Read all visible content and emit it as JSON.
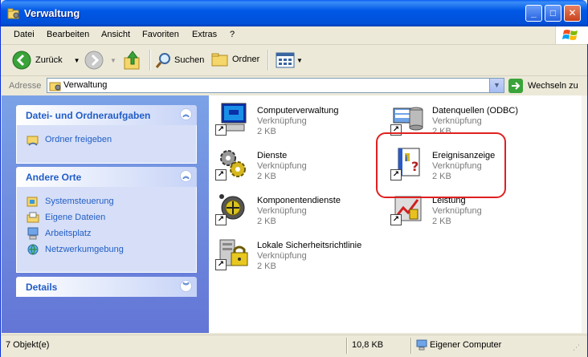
{
  "window": {
    "title": "Verwaltung"
  },
  "menu": [
    "Datei",
    "Bearbeiten",
    "Ansicht",
    "Favoriten",
    "Extras",
    "?"
  ],
  "toolbar": {
    "back_label": "Zurück",
    "search_label": "Suchen",
    "folders_label": "Ordner"
  },
  "address": {
    "label": "Adresse",
    "value": "Verwaltung",
    "go_label": "Wechseln zu"
  },
  "panels": {
    "tasks": {
      "title": "Datei- und Ordneraufgaben",
      "items": [
        "Ordner freigeben"
      ]
    },
    "places": {
      "title": "Andere Orte",
      "items": [
        "Systemsteuerung",
        "Eigene Dateien",
        "Arbeitsplatz",
        "Netzwerkumgebung"
      ]
    },
    "details": {
      "title": "Details"
    }
  },
  "files": [
    {
      "name": "Computerverwaltung",
      "type": "Verknüpfung",
      "size": "2 KB"
    },
    {
      "name": "Datenquellen (ODBC)",
      "type": "Verknüpfung",
      "size": "2 KB"
    },
    {
      "name": "Dienste",
      "type": "Verknüpfung",
      "size": "2 KB"
    },
    {
      "name": "Ereignisanzeige",
      "type": "Verknüpfung",
      "size": "2 KB"
    },
    {
      "name": "Komponentendienste",
      "type": "Verknüpfung",
      "size": "2 KB"
    },
    {
      "name": "Leistung",
      "type": "Verknüpfung",
      "size": "2 KB"
    },
    {
      "name": "Lokale Sicherheitsrichtlinie",
      "type": "Verknüpfung",
      "size": "2 KB"
    }
  ],
  "status": {
    "count": "7 Objekt(e)",
    "size": "10,8 KB",
    "zone": "Eigener Computer"
  },
  "colors": {
    "titlebar": "#0058e6",
    "task_link": "#215dc6",
    "highlight": "#e02020"
  }
}
